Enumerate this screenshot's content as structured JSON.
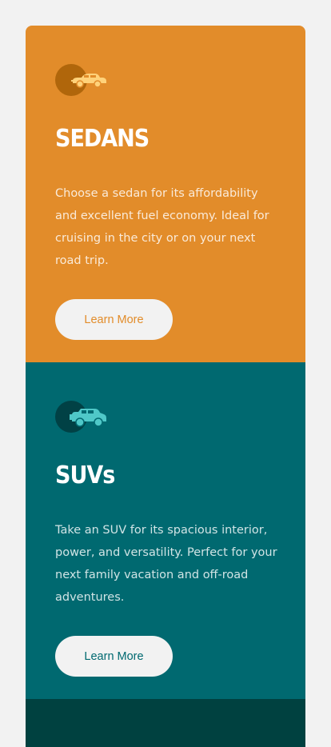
{
  "cards": [
    {
      "icon": "sedan-car-icon",
      "title": "SEDANS",
      "description": "Choose a sedan for its affordability and excellent fuel economy. Ideal for cruising in the city or on your next road trip.",
      "button_label": "Learn More",
      "color": "#e28c2a"
    },
    {
      "icon": "suv-car-icon",
      "title": "SUVs",
      "description": "Take an SUV for its spacious interior, power, and versatility. Perfect for your next family vacation and off-road adventures.",
      "button_label": "Learn More",
      "color": "#006970"
    },
    {
      "color": "#004140"
    }
  ],
  "page_background": "#f2f2f2"
}
